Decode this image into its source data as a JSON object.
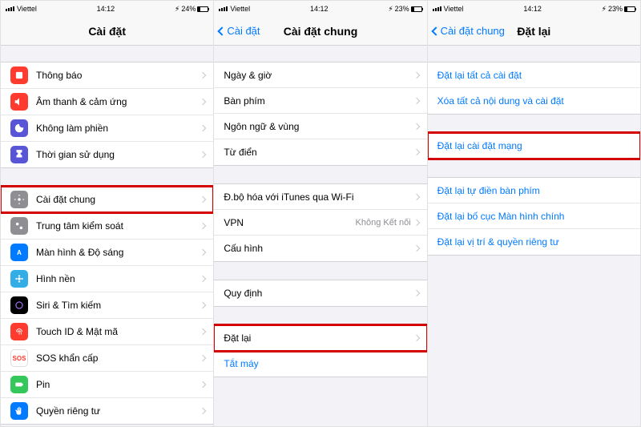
{
  "status": {
    "carrier": "Viettel",
    "time": "14:12",
    "batt1": "24%",
    "batt2": "23%",
    "batt3": "23%",
    "charge": "⚡︎"
  },
  "p1": {
    "title": "Cài đặt",
    "items": {
      "notify": "Thông báo",
      "sound": "Âm thanh & cảm ứng",
      "dnd": "Không làm phiền",
      "screentime": "Thời gian sử dụng",
      "general": "Cài đặt chung",
      "control": "Trung tâm kiểm soát",
      "display": "Màn hình & Độ sáng",
      "wallpaper": "Hình nền",
      "siri": "Siri & Tìm kiếm",
      "touchid": "Touch ID & Mật mã",
      "sos": "SOS khẩn cấp",
      "battery": "Pin",
      "privacy": "Quyền riêng tư"
    }
  },
  "p2": {
    "back": "Cài đặt",
    "title": "Cài đặt chung",
    "items": {
      "date": "Ngày & giờ",
      "keyboard": "Bàn phím",
      "lang": "Ngôn ngữ & vùng",
      "dict": "Từ điển",
      "itunes": "Đ.bộ hóa với iTunes qua Wi-Fi",
      "vpn": "VPN",
      "vpn_detail": "Không Kết nối",
      "profile": "Cấu hình",
      "regulatory": "Quy định",
      "reset": "Đặt lại",
      "shutdown": "Tắt máy"
    }
  },
  "p3": {
    "back": "Cài đặt chung",
    "title": "Đặt lại",
    "items": {
      "all": "Đặt lại tất cả cài đặt",
      "erase": "Xóa tất cả nội dung và cài đặt",
      "network": "Đặt lại cài đặt mạng",
      "kbdict": "Đặt lại tự điền bàn phím",
      "home": "Đặt lại bố cục Màn hình chính",
      "location": "Đặt lại vị trí & quyền riêng tư"
    }
  }
}
